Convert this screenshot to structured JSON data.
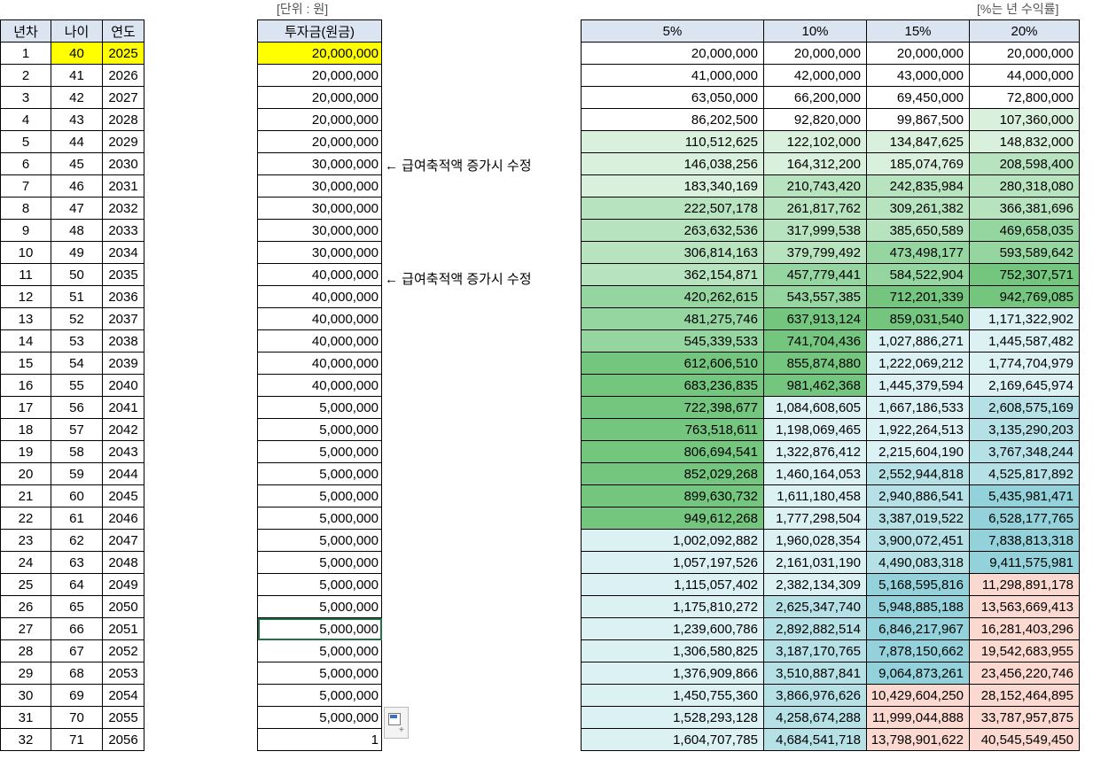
{
  "unit_label": "[단위 : 원]",
  "pct_label": "[%는 년 수익률]",
  "headers": {
    "year_no": "년차",
    "age": "나이",
    "year": "연도",
    "invest": "투자금(원금)"
  },
  "return_headers": [
    "5%",
    "10%",
    "15%",
    "20%"
  ],
  "note_text": "← 급여축적액 증가시 수정",
  "year_no": [
    "1",
    "2",
    "3",
    "4",
    "5",
    "6",
    "7",
    "8",
    "9",
    "10",
    "11",
    "12",
    "13",
    "14",
    "15",
    "16",
    "17",
    "18",
    "19",
    "20",
    "21",
    "22",
    "23",
    "24",
    "25",
    "26",
    "27",
    "28",
    "29",
    "30",
    "31",
    "32"
  ],
  "age": [
    "40",
    "41",
    "42",
    "43",
    "44",
    "45",
    "46",
    "47",
    "48",
    "49",
    "50",
    "51",
    "52",
    "53",
    "54",
    "55",
    "56",
    "57",
    "58",
    "59",
    "60",
    "61",
    "62",
    "63",
    "64",
    "65",
    "66",
    "67",
    "68",
    "69",
    "70",
    "71"
  ],
  "year": [
    "2025",
    "2026",
    "2027",
    "2028",
    "2029",
    "2030",
    "2031",
    "2032",
    "2033",
    "2034",
    "2035",
    "2036",
    "2037",
    "2038",
    "2039",
    "2040",
    "2041",
    "2042",
    "2043",
    "2044",
    "2045",
    "2046",
    "2047",
    "2048",
    "2049",
    "2050",
    "2051",
    "2052",
    "2053",
    "2054",
    "2055",
    "2056"
  ],
  "invest": [
    "20,000,000",
    "20,000,000",
    "20,000,000",
    "20,000,000",
    "20,000,000",
    "30,000,000",
    "30,000,000",
    "30,000,000",
    "30,000,000",
    "30,000,000",
    "40,000,000",
    "40,000,000",
    "40,000,000",
    "40,000,000",
    "40,000,000",
    "40,000,000",
    "5,000,000",
    "5,000,000",
    "5,000,000",
    "5,000,000",
    "5,000,000",
    "5,000,000",
    "5,000,000",
    "5,000,000",
    "5,000,000",
    "5,000,000",
    "5,000,000",
    "5,000,000",
    "5,000,000",
    "5,000,000",
    "5,000,000",
    "1"
  ],
  "returns": [
    [
      "20,000,000",
      "20,000,000",
      "20,000,000",
      "20,000,000"
    ],
    [
      "41,000,000",
      "42,000,000",
      "43,000,000",
      "44,000,000"
    ],
    [
      "63,050,000",
      "66,200,000",
      "69,450,000",
      "72,800,000"
    ],
    [
      "86,202,500",
      "92,820,000",
      "99,867,500",
      "107,360,000"
    ],
    [
      "110,512,625",
      "122,102,000",
      "134,847,625",
      "148,832,000"
    ],
    [
      "146,038,256",
      "164,312,200",
      "185,074,769",
      "208,598,400"
    ],
    [
      "183,340,169",
      "210,743,420",
      "242,835,984",
      "280,318,080"
    ],
    [
      "222,507,178",
      "261,817,762",
      "309,261,382",
      "366,381,696"
    ],
    [
      "263,632,536",
      "317,999,538",
      "385,650,589",
      "469,658,035"
    ],
    [
      "306,814,163",
      "379,799,492",
      "473,498,177",
      "593,589,642"
    ],
    [
      "362,154,871",
      "457,779,441",
      "584,522,904",
      "752,307,571"
    ],
    [
      "420,262,615",
      "543,557,385",
      "712,201,339",
      "942,769,085"
    ],
    [
      "481,275,746",
      "637,913,124",
      "859,031,540",
      "1,171,322,902"
    ],
    [
      "545,339,533",
      "741,704,436",
      "1,027,886,271",
      "1,445,587,482"
    ],
    [
      "612,606,510",
      "855,874,880",
      "1,222,069,212",
      "1,774,704,979"
    ],
    [
      "683,236,835",
      "981,462,368",
      "1,445,379,594",
      "2,169,645,974"
    ],
    [
      "722,398,677",
      "1,084,608,605",
      "1,667,186,533",
      "2,608,575,169"
    ],
    [
      "763,518,611",
      "1,198,069,465",
      "1,922,264,513",
      "3,135,290,203"
    ],
    [
      "806,694,541",
      "1,322,876,412",
      "2,215,604,190",
      "3,767,348,244"
    ],
    [
      "852,029,268",
      "1,460,164,053",
      "2,552,944,818",
      "4,525,817,892"
    ],
    [
      "899,630,732",
      "1,611,180,458",
      "2,940,886,541",
      "5,435,981,471"
    ],
    [
      "949,612,268",
      "1,777,298,504",
      "3,387,019,522",
      "6,528,177,765"
    ],
    [
      "1,002,092,882",
      "1,960,028,354",
      "3,900,072,451",
      "7,838,813,318"
    ],
    [
      "1,057,197,526",
      "2,161,031,190",
      "4,490,083,318",
      "9,411,575,981"
    ],
    [
      "1,115,057,402",
      "2,382,134,309",
      "5,168,595,816",
      "11,298,891,178"
    ],
    [
      "1,175,810,272",
      "2,625,347,740",
      "5,948,885,188",
      "13,563,669,413"
    ],
    [
      "1,239,600,786",
      "2,892,882,514",
      "6,846,217,967",
      "16,281,403,296"
    ],
    [
      "1,306,580,825",
      "3,187,170,765",
      "7,878,150,662",
      "19,542,683,955"
    ],
    [
      "1,376,909,866",
      "3,510,887,841",
      "9,064,873,261",
      "23,456,220,746"
    ],
    [
      "1,450,755,360",
      "3,866,976,626",
      "10,429,604,250",
      "28,152,464,895"
    ],
    [
      "1,528,293,128",
      "4,258,674,288",
      "11,999,044,888",
      "33,787,957,875"
    ],
    [
      "1,604,707,785",
      "4,684,541,718",
      "13,798,901,622",
      "40,545,549,450"
    ]
  ],
  "colors": {
    "header_bg": "#dbe5f1",
    "highlight_yellow": "#ffff00",
    "green_1": "#d9f0dc",
    "green_2": "#b8e3bf",
    "green_3": "#95d5a0",
    "green_4": "#74c67f",
    "teal_1": "#dbf1f3",
    "teal_2": "#b5e1e6",
    "teal_3": "#93d2db",
    "salmon": "#fcd9d0",
    "selection": "#217346"
  }
}
